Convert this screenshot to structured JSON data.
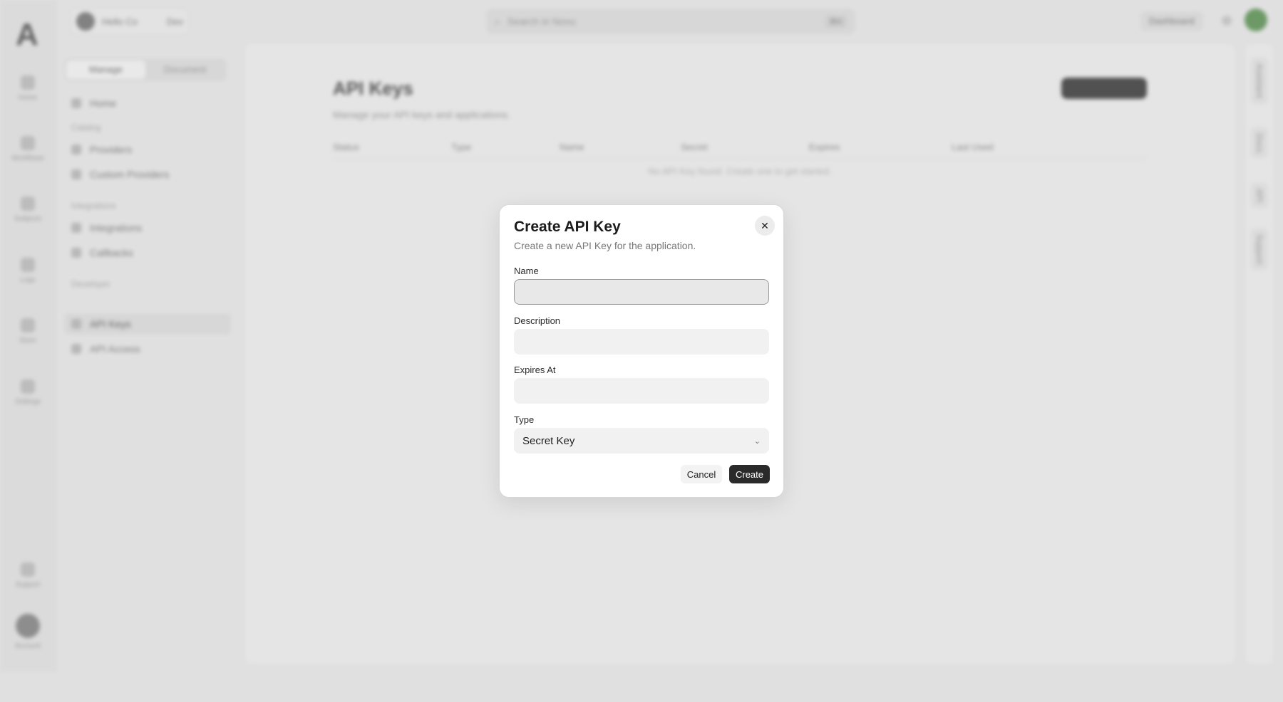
{
  "nav_rail": {
    "items": [
      {
        "label": "Home",
        "icon": "home-icon"
      },
      {
        "label": "Workflows",
        "icon": "workflow-icon"
      },
      {
        "label": "Subjects",
        "icon": "subjects-icon"
      },
      {
        "label": "Logs",
        "icon": "logs-icon"
      },
      {
        "label": "Store",
        "icon": "store-icon"
      },
      {
        "label": "Settings",
        "icon": "settings-icon"
      }
    ],
    "bottom": [
      {
        "label": "Support",
        "icon": "support-icon"
      },
      {
        "label": "Account",
        "icon": "account-avatar"
      }
    ]
  },
  "topbar": {
    "org_name": "Hello Co",
    "org_badge": "Dev",
    "search_placeholder": "Search in Novu",
    "search_shortcut": "⌘K",
    "dashboard_label": "Dashboard"
  },
  "sidebar": {
    "tabs": [
      "Manage",
      "Document"
    ],
    "home": "Home",
    "groups": [
      {
        "title": "Catalog",
        "items": [
          "Providers",
          "Custom Providers"
        ]
      },
      {
        "title": "Integrations",
        "items": [
          "Integrations",
          "Callbacks"
        ]
      },
      {
        "title": "Developer",
        "items": [
          "API Keys",
          "API Access"
        ]
      }
    ]
  },
  "main": {
    "title": "API Keys",
    "subtitle": "Manage your API keys and applications.",
    "columns": [
      "Status",
      "Type",
      "Name",
      "Secret",
      "Expires",
      "Last Used"
    ],
    "empty": "No API Key found. Create one to get started."
  },
  "right_panel": {
    "tabs": [
      "Assistant",
      "Docs",
      "API",
      "Support"
    ]
  },
  "modal": {
    "title": "Create API Key",
    "description": "Create a new API Key for the application.",
    "name_label": "Name",
    "name_value": "",
    "description_label": "Description",
    "description_value": "",
    "expires_label": "Expires At",
    "expires_value": "",
    "type_label": "Type",
    "type_value": "Secret Key",
    "cancel_label": "Cancel",
    "create_label": "Create",
    "close_glyph": "✕"
  },
  "colors": {
    "primary_button": "#2a2a2a",
    "avatar_green": "#4f8a46"
  }
}
